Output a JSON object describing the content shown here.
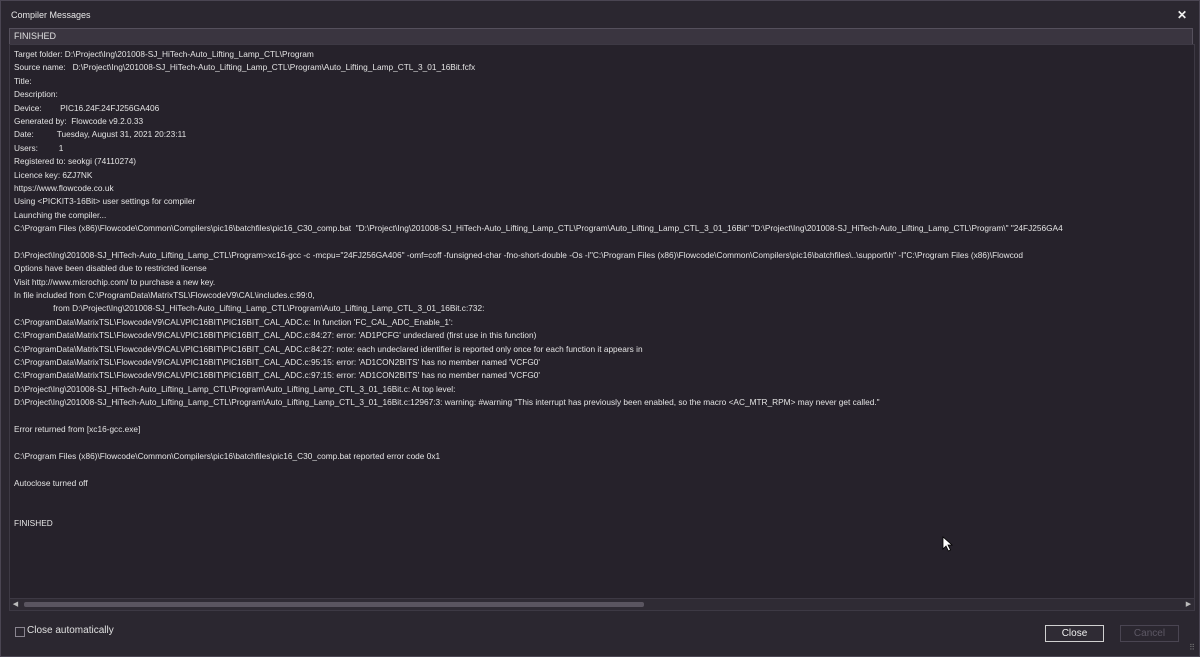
{
  "window": {
    "title": "Compiler Messages",
    "close_glyph": "✕"
  },
  "status": {
    "text": "FINISHED"
  },
  "output": {
    "lines": [
      "Target folder: D:\\Project\\Ing\\201008-SJ_HiTech-Auto_Lifting_Lamp_CTL\\Program",
      "Source name:   D:\\Project\\Ing\\201008-SJ_HiTech-Auto_Lifting_Lamp_CTL\\Program\\Auto_Lifting_Lamp_CTL_3_01_16Bit.fcfx",
      "Title:",
      "Description:",
      "Device:        PIC16.24F.24FJ256GA406",
      "Generated by:  Flowcode v9.2.0.33",
      "Date:          Tuesday, August 31, 2021 20:23:11",
      "Users:         1",
      "Registered to: seokgi (74110274)",
      "Licence key: 6ZJ7NK",
      "https://www.flowcode.co.uk",
      "Using <PICKIT3-16Bit> user settings for compiler",
      "Launching the compiler...",
      "C:\\Program Files (x86)\\Flowcode\\Common\\Compilers\\pic16\\batchfiles\\pic16_C30_comp.bat  \"D:\\Project\\Ing\\201008-SJ_HiTech-Auto_Lifting_Lamp_CTL\\Program\\Auto_Lifting_Lamp_CTL_3_01_16Bit\" \"D:\\Project\\Ing\\201008-SJ_HiTech-Auto_Lifting_Lamp_CTL\\Program\\\" \"24FJ256GA4",
      "",
      "D:\\Project\\Ing\\201008-SJ_HiTech-Auto_Lifting_Lamp_CTL\\Program>xc16-gcc -c -mcpu=\"24FJ256GA406\" -omf=coff -funsigned-char -fno-short-double -Os -I\"C:\\Program Files (x86)\\Flowcode\\Common\\Compilers\\pic16\\batchfiles\\..\\support\\h\" -I\"C:\\Program Files (x86)\\Flowcod",
      "Options have been disabled due to restricted license",
      "Visit http://www.microchip.com/ to purchase a new key.",
      "In file included from C:\\ProgramData\\MatrixTSL\\FlowcodeV9\\CAL\\includes.c:99:0,",
      "                 from D:\\Project\\Ing\\201008-SJ_HiTech-Auto_Lifting_Lamp_CTL\\Program\\Auto_Lifting_Lamp_CTL_3_01_16Bit.c:732:",
      "C:\\ProgramData\\MatrixTSL\\FlowcodeV9\\CAL\\/PIC16BIT\\PIC16BIT_CAL_ADC.c: In function 'FC_CAL_ADC_Enable_1':",
      "C:\\ProgramData\\MatrixTSL\\FlowcodeV9\\CAL\\/PIC16BIT\\PIC16BIT_CAL_ADC.c:84:27: error: 'AD1PCFG' undeclared (first use in this function)",
      "C:\\ProgramData\\MatrixTSL\\FlowcodeV9\\CAL\\/PIC16BIT\\PIC16BIT_CAL_ADC.c:84:27: note: each undeclared identifier is reported only once for each function it appears in",
      "C:\\ProgramData\\MatrixTSL\\FlowcodeV9\\CAL\\/PIC16BIT\\PIC16BIT_CAL_ADC.c:95:15: error: 'AD1CON2BITS' has no member named 'VCFG0'",
      "C:\\ProgramData\\MatrixTSL\\FlowcodeV9\\CAL\\/PIC16BIT\\PIC16BIT_CAL_ADC.c:97:15: error: 'AD1CON2BITS' has no member named 'VCFG0'",
      "D:\\Project\\Ing\\201008-SJ_HiTech-Auto_Lifting_Lamp_CTL\\Program\\Auto_Lifting_Lamp_CTL_3_01_16Bit.c: At top level:",
      "D:\\Project\\Ing\\201008-SJ_HiTech-Auto_Lifting_Lamp_CTL\\Program\\Auto_Lifting_Lamp_CTL_3_01_16Bit.c:12967:3: warning: #warning \"This interrupt has previously been enabled, so the macro <AC_MTR_RPM> may never get called.\"",
      "",
      "Error returned from [xc16-gcc.exe]",
      "",
      "C:\\Program Files (x86)\\Flowcode\\Common\\Compilers\\pic16\\batchfiles\\pic16_C30_comp.bat reported error code 0x1",
      "",
      "Autoclose turned off",
      "",
      "",
      "FINISHED"
    ]
  },
  "footer": {
    "close_automatically_label": "Close automatically",
    "close_automatically_checked": false,
    "close_button": "Close",
    "cancel_button": "Cancel"
  },
  "colors": {
    "background": "#2b2730",
    "output_background": "#26222b",
    "text": "#e4e4e4",
    "disabled_text": "#5d5865"
  }
}
